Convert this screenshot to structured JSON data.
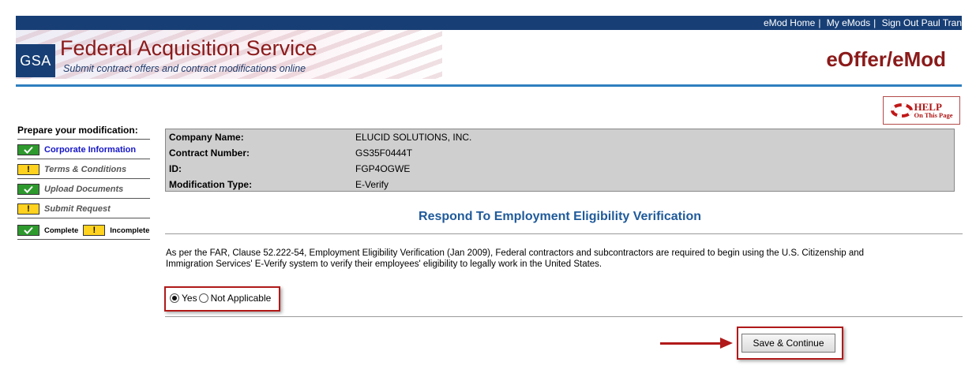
{
  "header": {
    "links": [
      "eMod Home",
      "My eMods",
      "Sign Out Paul Tran"
    ],
    "logo_text": "GSA",
    "title": "Federal Acquisition Service",
    "subtitle": "Submit contract offers and contract modifications online",
    "brand": "eOffer/eMod",
    "accent_color": "#173f76",
    "title_color": "#8b1a1a"
  },
  "help": {
    "label": "HELP",
    "sub": "On This Page",
    "icon": "lifebuoy-icon"
  },
  "sidebar": {
    "title": "Prepare your modification:",
    "items": [
      {
        "label": "Corporate Information",
        "status": "complete"
      },
      {
        "label": "Terms & Conditions",
        "status": "incomplete"
      },
      {
        "label": "Upload Documents",
        "status": "complete"
      },
      {
        "label": "Submit Request",
        "status": "incomplete"
      }
    ],
    "legend": {
      "complete": "Complete",
      "incomplete": "Incomplete"
    }
  },
  "info": {
    "rows": [
      {
        "label": "Company Name:",
        "value": "ELUCID SOLUTIONS, INC."
      },
      {
        "label": "Contract Number:",
        "value": "GS35F0444T"
      },
      {
        "label": "ID:",
        "value": "FGP4OGWE"
      },
      {
        "label": "Modification Type:",
        "value": "E-Verify"
      }
    ]
  },
  "main": {
    "heading": "Respond To Employment Eligibility Verification",
    "paragraph": "As per the FAR, Clause 52.222-54, Employment Eligibility Verification (Jan 2009), Federal contractors and subcontractors are required to begin using the U.S. Citizenship and Immigration Services' E-Verify system to verify their employees' eligibility to legally work in the United States.",
    "options": [
      {
        "label": "Yes",
        "selected": true
      },
      {
        "label": "Not Applicable",
        "selected": false
      }
    ],
    "submit_label": "Save & Continue"
  }
}
